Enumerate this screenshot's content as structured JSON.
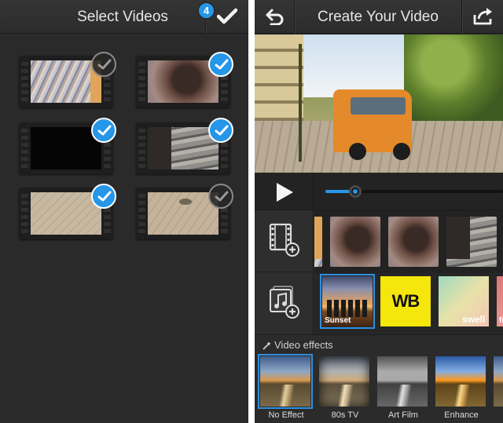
{
  "left_screen": {
    "title": "Select Videos",
    "selected_count": "4",
    "videos": [
      {
        "selected": false
      },
      {
        "selected": true
      },
      {
        "selected": true
      },
      {
        "selected": true
      },
      {
        "selected": true
      },
      {
        "selected": false
      }
    ]
  },
  "right_screen": {
    "title": "Create Your Video",
    "playback_progress": 0.17,
    "themes": [
      {
        "label": "Sunset"
      },
      {
        "label": "WB"
      },
      {
        "label": "swell"
      },
      {
        "label": "fr"
      }
    ],
    "effects": {
      "section_title": "Video effects",
      "items": [
        {
          "label": "No Effect",
          "selected": true
        },
        {
          "label": "80s TV",
          "selected": false
        },
        {
          "label": "Art Film",
          "selected": false
        },
        {
          "label": "Enhance",
          "selected": false
        }
      ]
    }
  },
  "colors": {
    "accent": "#2596e8",
    "theme_wb_background": "#f5e60c",
    "header": "#323232",
    "background": "#2b2b2b"
  }
}
